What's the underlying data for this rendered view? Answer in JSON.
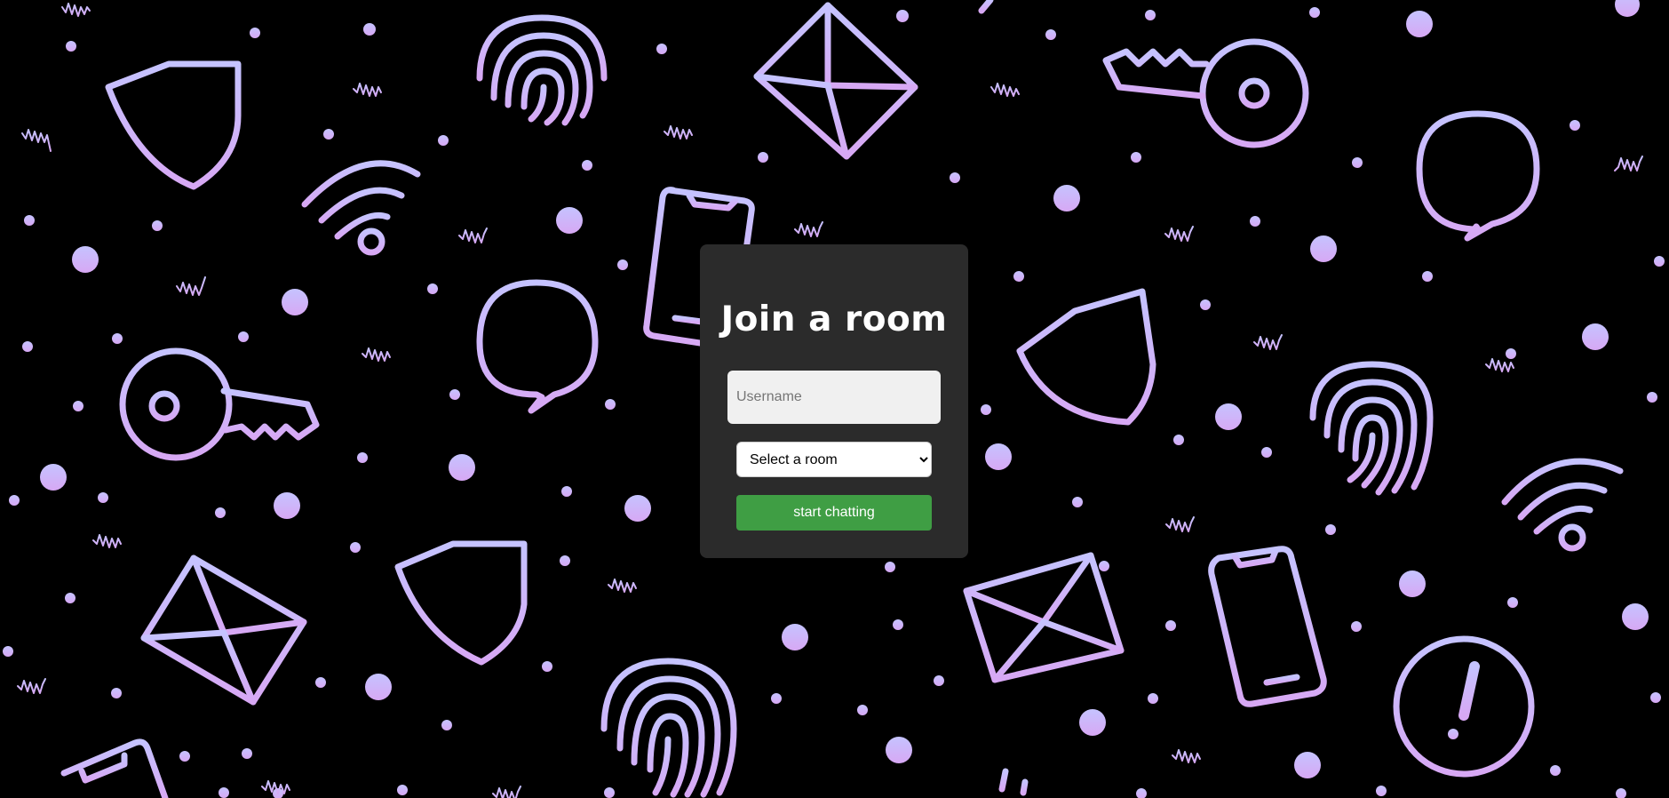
{
  "join_form": {
    "title": "Join a room",
    "username_placeholder": "Username",
    "username_value": "",
    "room_select_selected": "Select a room",
    "submit_label": "start chatting"
  },
  "colors": {
    "background": "#000000",
    "pattern": "#c9b8f5",
    "card": "#2b2b2b",
    "submit_button": "#3f9e44"
  },
  "background_icons": [
    "shield-icon",
    "fingerprint-icon",
    "envelope-icon",
    "key-icon",
    "speech-bubble-icon",
    "wifi-icon",
    "smartphone-icon",
    "alert-icon",
    "dot",
    "squiggle"
  ]
}
